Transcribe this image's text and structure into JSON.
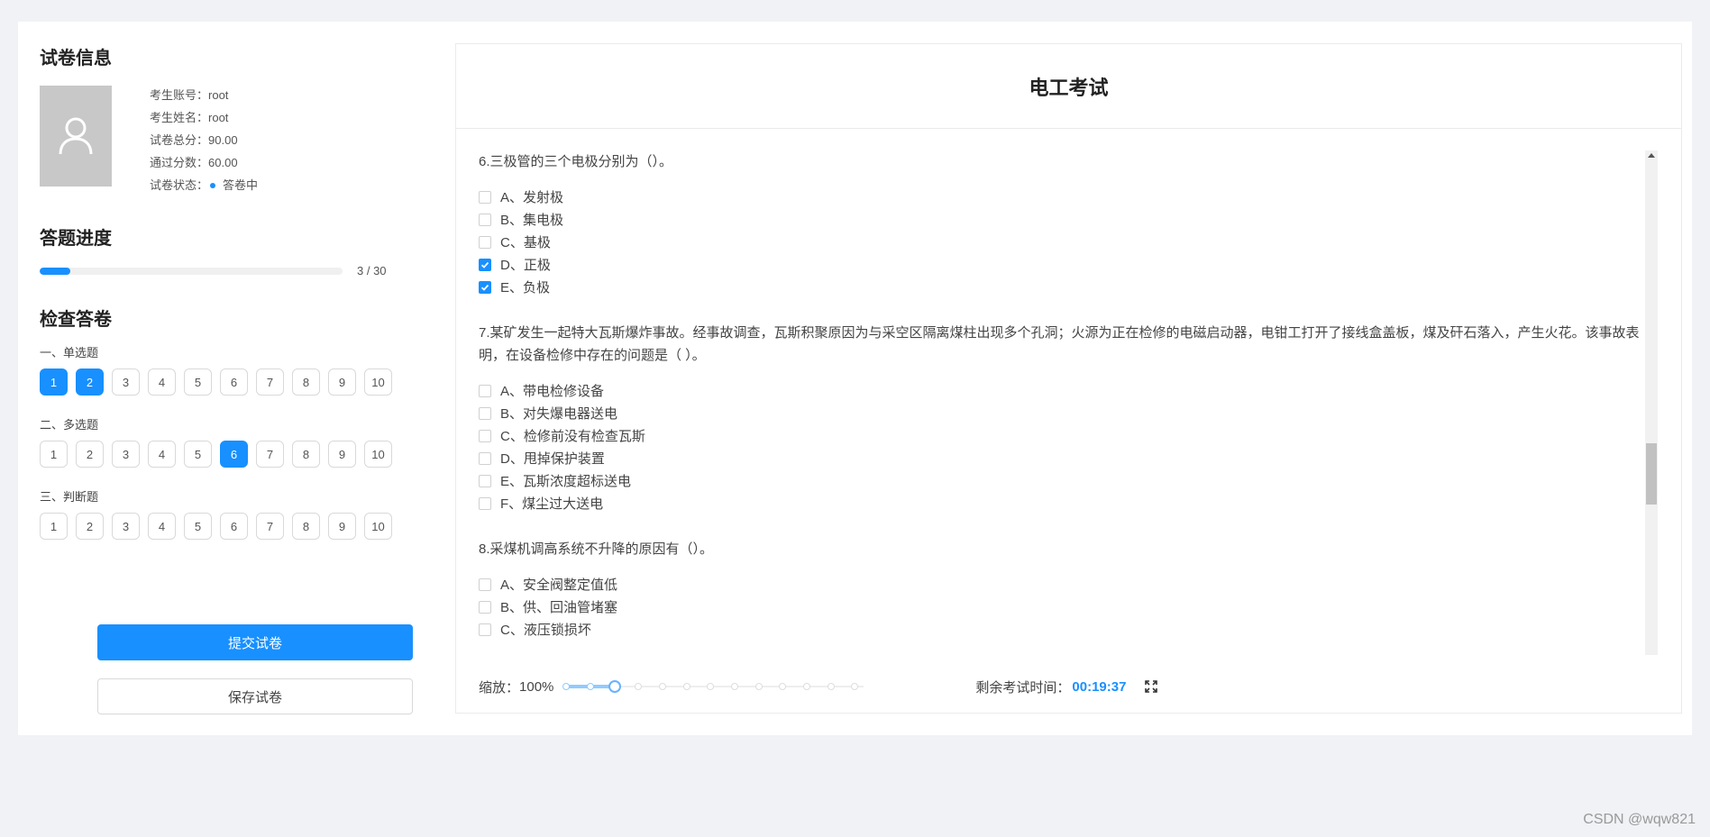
{
  "exam_info": {
    "title": "试卷信息",
    "fields": [
      {
        "label": "考生账号：",
        "value": "root"
      },
      {
        "label": "考生姓名：",
        "value": "root"
      },
      {
        "label": "试卷总分：",
        "value": "90.00"
      },
      {
        "label": "通过分数：",
        "value": "60.00"
      },
      {
        "label": "试卷状态：",
        "value": "答卷中"
      }
    ]
  },
  "progress": {
    "title": "答题进度",
    "answered": 3,
    "total": 30,
    "fraction": 0.1,
    "text": "3 / 30"
  },
  "check": {
    "title": "检查答卷",
    "groups": [
      {
        "label": "一、单选题",
        "buttons": [
          "1",
          "2",
          "3",
          "4",
          "5",
          "6",
          "7",
          "8",
          "9",
          "10"
        ],
        "answered": [
          1,
          2
        ]
      },
      {
        "label": "二、多选题",
        "buttons": [
          "1",
          "2",
          "3",
          "4",
          "5",
          "6",
          "7",
          "8",
          "9",
          "10"
        ],
        "answered": [
          6
        ]
      },
      {
        "label": "三、判断题",
        "buttons": [
          "1",
          "2",
          "3",
          "4",
          "5",
          "6",
          "7",
          "8",
          "9",
          "10"
        ],
        "answered": []
      }
    ]
  },
  "actions": {
    "submit": "提交试卷",
    "save": "保存试卷"
  },
  "exam": {
    "title": "电工考试",
    "questions": [
      {
        "text": "6.三极管的三个电极分别为（）。",
        "options": [
          {
            "label": "A、发射极",
            "checked": false
          },
          {
            "label": "B、集电极",
            "checked": false
          },
          {
            "label": "C、基极",
            "checked": false
          },
          {
            "label": "D、正极",
            "checked": true
          },
          {
            "label": "E、负极",
            "checked": true
          }
        ]
      },
      {
        "text": "7.某矿发生一起特大瓦斯爆炸事故。经事故调查，瓦斯积聚原因为与采空区隔离煤柱出现多个孔洞；火源为正在检修的电磁启动器，电钳工打开了接线盒盖板，煤及矸石落入，产生火花。该事故表明，在设备检修中存在的问题是（ ）。",
        "options": [
          {
            "label": "A、带电检修设备",
            "checked": false
          },
          {
            "label": "B、对失爆电器送电",
            "checked": false
          },
          {
            "label": "C、检修前没有检查瓦斯",
            "checked": false
          },
          {
            "label": "D、甩掉保护装置",
            "checked": false
          },
          {
            "label": "E、瓦斯浓度超标送电",
            "checked": false
          },
          {
            "label": "F、煤尘过大送电",
            "checked": false
          }
        ]
      },
      {
        "text": "8.采煤机调高系统不升降的原因有（）。",
        "options": [
          {
            "label": "A、安全阀整定值低",
            "checked": false
          },
          {
            "label": "B、供、回油管堵塞",
            "checked": false
          },
          {
            "label": "C、液压锁损坏",
            "checked": false
          }
        ]
      }
    ]
  },
  "footer": {
    "zoom_label": "缩放：",
    "zoom_value": "100%",
    "zoom_level": 2,
    "zoom_steps": 13,
    "timer_label": "剩余考试时间：",
    "timer_value": "00:19:37"
  },
  "watermark": "CSDN @wqw821",
  "colors": {
    "accent": "#1890ff"
  }
}
